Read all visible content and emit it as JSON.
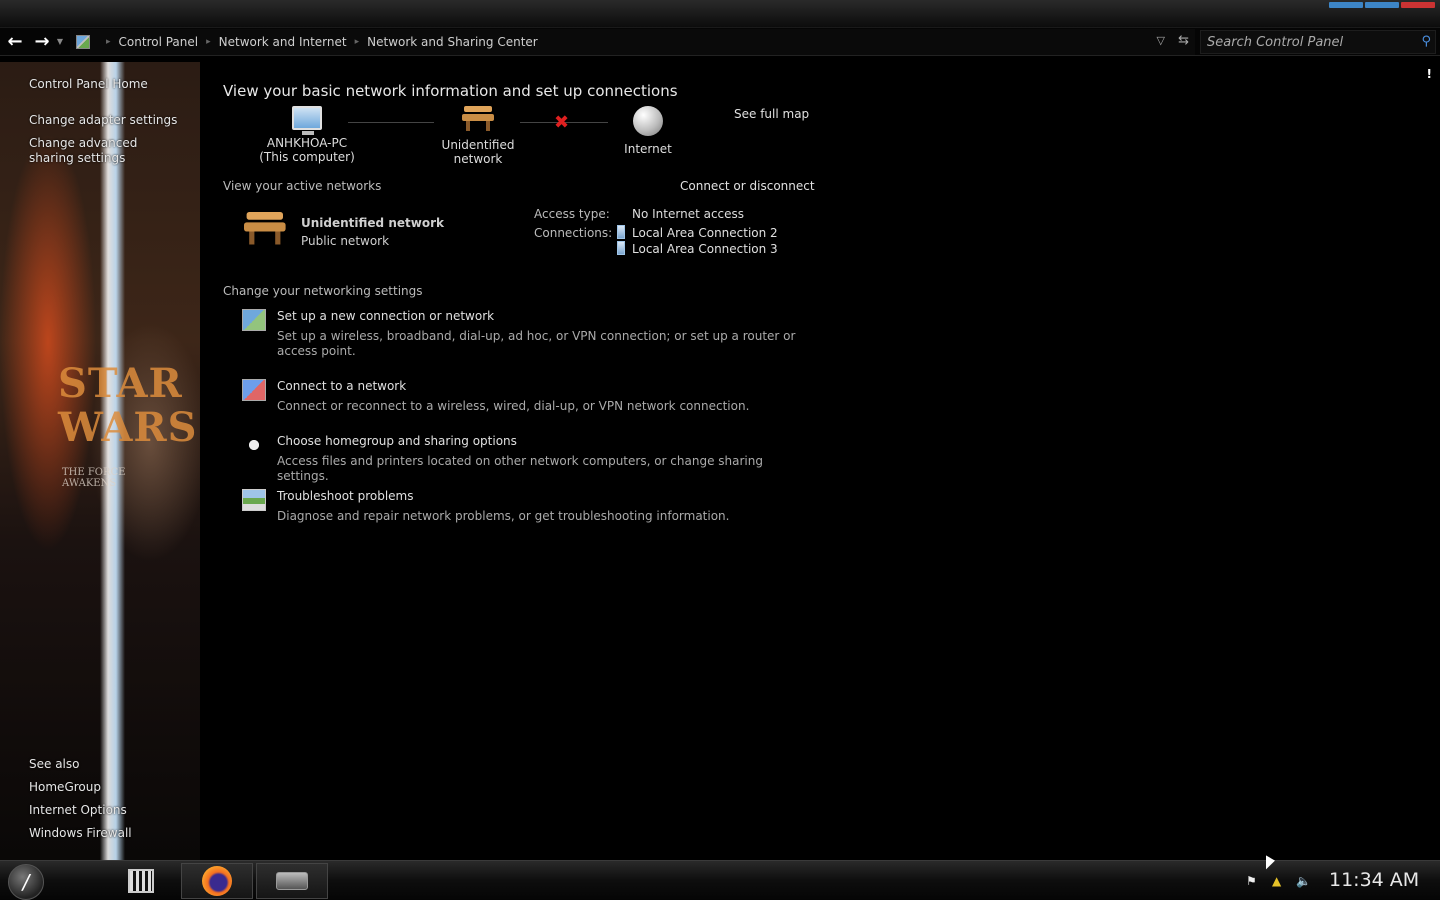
{
  "window": {
    "caption_buttons": [
      "minimize",
      "maximize",
      "close"
    ],
    "colors": {
      "min": "#3d85c6",
      "max": "#3d85c6",
      "close": "#cc3333"
    }
  },
  "address": {
    "crumbs": [
      "Control Panel",
      "Network and Internet",
      "Network and Sharing Center"
    ],
    "search_placeholder": "Search Control Panel"
  },
  "sidebar": {
    "home": "Control Panel Home",
    "links": [
      "Change adapter settings",
      "Change advanced sharing settings"
    ],
    "see_also_title": "See also",
    "see_also": [
      "HomeGroup",
      "Internet Options",
      "Windows Firewall"
    ],
    "wallpaper_title": "STAR WARS",
    "wallpaper_subtitle": "THE FORCE AWAKENS"
  },
  "main": {
    "heading": "View your basic network information and set up connections",
    "see_full_map": "See full map",
    "map": {
      "computer_name": "ANHKHOA-PC",
      "computer_sub": "(This computer)",
      "network": "Unidentified network",
      "internet": "Internet"
    },
    "active_networks_label": "View your active networks",
    "connect_or_disconnect": "Connect or disconnect",
    "active": {
      "name": "Unidentified network",
      "type": "Public network",
      "access_type_label": "Access type:",
      "access_type_value": "No Internet access",
      "connections_label": "Connections:",
      "connections": [
        "Local Area Connection 2",
        "Local Area Connection 3"
      ]
    },
    "change_settings_label": "Change your networking settings",
    "tasks": [
      {
        "title": "Set up a new connection or network",
        "desc": "Set up a wireless, broadband, dial-up, ad hoc, or VPN connection; or set up a router or access point."
      },
      {
        "title": "Connect to a network",
        "desc": "Connect or reconnect to a wireless, wired, dial-up, or VPN network connection."
      },
      {
        "title": "Choose homegroup and sharing options",
        "desc": "Access files and printers located on other network computers, or change sharing settings."
      },
      {
        "title": "Troubleshoot problems",
        "desc": "Diagnose and repair network problems, or get troubleshooting information."
      }
    ]
  },
  "taskbar": {
    "apps": [
      "film-app",
      "firefox",
      "network-app"
    ],
    "clock": "11:34 AM"
  }
}
